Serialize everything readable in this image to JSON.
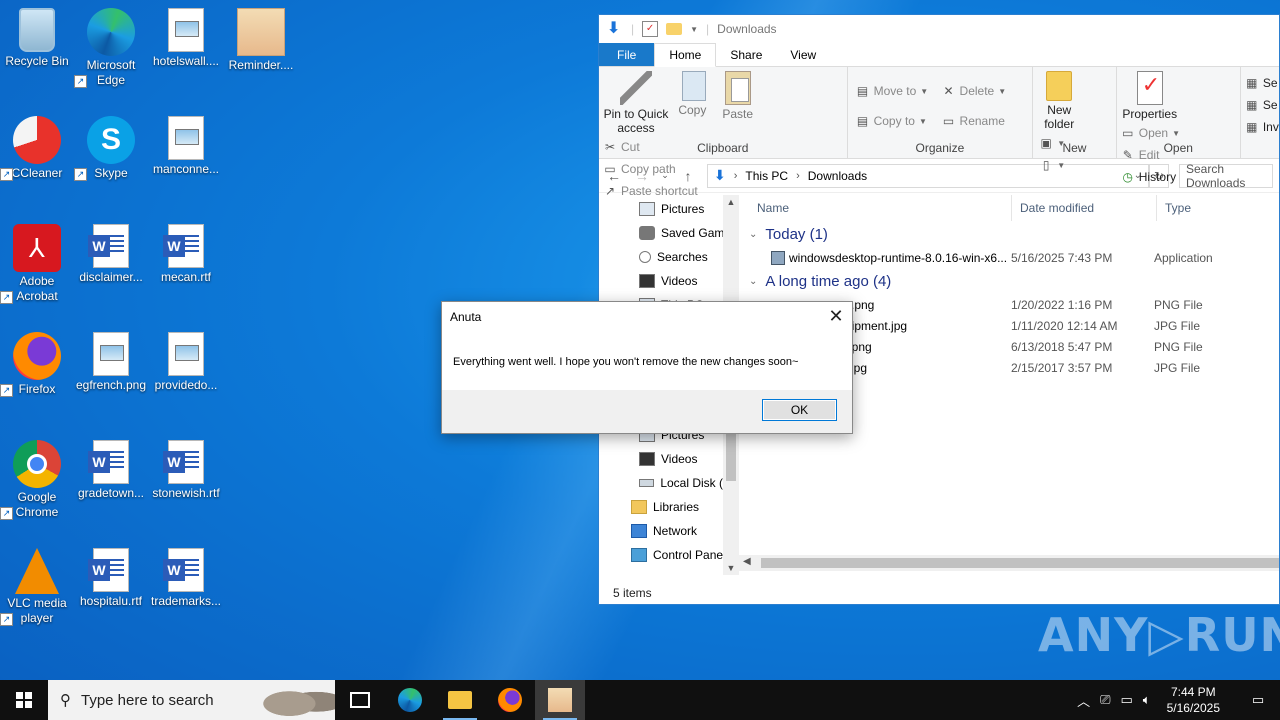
{
  "desktop": {
    "icons": [
      {
        "label": "Recycle Bin",
        "icon": "recycle-bin-icon"
      },
      {
        "label": "Microsoft Edge",
        "icon": "edge-icon"
      },
      {
        "label": "hotelswall....",
        "icon": "image-file-icon"
      },
      {
        "label": "Reminder....",
        "icon": "anime-app-icon"
      },
      {
        "label": "CCleaner",
        "icon": "ccleaner-icon"
      },
      {
        "label": "Skype",
        "icon": "skype-icon"
      },
      {
        "label": "manconne...",
        "icon": "image-file-icon"
      },
      {
        "label": "Adobe Acrobat",
        "icon": "acrobat-icon"
      },
      {
        "label": "disclaimer...",
        "icon": "word-doc-icon"
      },
      {
        "label": "mecan.rtf",
        "icon": "word-doc-icon"
      },
      {
        "label": "Firefox",
        "icon": "firefox-icon"
      },
      {
        "label": "egfrench.png",
        "icon": "image-file-icon"
      },
      {
        "label": "providedo...",
        "icon": "image-file-icon"
      },
      {
        "label": "Google Chrome",
        "icon": "chrome-icon"
      },
      {
        "label": "gradetown...",
        "icon": "word-doc-icon"
      },
      {
        "label": "stonewish.rtf",
        "icon": "word-doc-icon"
      },
      {
        "label": "VLC media player",
        "icon": "vlc-icon"
      },
      {
        "label": "hospitalu.rtf",
        "icon": "word-doc-icon"
      },
      {
        "label": "trademarks...",
        "icon": "word-doc-icon"
      }
    ]
  },
  "explorer": {
    "title": "Downloads",
    "tabs": [
      "File",
      "Home",
      "Share",
      "View"
    ],
    "ribbon": {
      "clipboard": {
        "pin": "Pin to Quick access",
        "copy": "Copy",
        "paste": "Paste",
        "cut": "Cut",
        "copy_path": "Copy path",
        "paste_shortcut": "Paste shortcut",
        "label": "Clipboard"
      },
      "organize": {
        "move_to": "Move to",
        "copy_to": "Copy to",
        "delete": "Delete",
        "rename": "Rename",
        "label": "Organize"
      },
      "new": {
        "new_folder": "New folder",
        "label": "New"
      },
      "open": {
        "properties": "Properties",
        "open": "Open",
        "edit": "Edit",
        "history": "History",
        "label": "Open"
      },
      "select": {
        "a": "Se",
        "b": "Se",
        "c": "Inv"
      }
    },
    "address": {
      "path": [
        "This PC",
        "Downloads"
      ],
      "search_placeholder": "Search Downloads"
    },
    "nav_pane": [
      {
        "label": "Pictures",
        "icon": "pictures-icon"
      },
      {
        "label": "Saved Games",
        "icon": "saved-games-icon"
      },
      {
        "label": "Searches",
        "icon": "searches-icon"
      },
      {
        "label": "Videos",
        "icon": "videos-icon"
      },
      {
        "label": "This PC",
        "icon": "this-pc-icon"
      }
    ],
    "nav_pane_lower": [
      {
        "label": "Pictures",
        "icon": "pictures-icon"
      },
      {
        "label": "Videos",
        "icon": "videos-icon"
      },
      {
        "label": "Local Disk (C:)",
        "icon": "disk-icon"
      },
      {
        "label": "Libraries",
        "icon": "libraries-icon"
      },
      {
        "label": "Network",
        "icon": "network-icon"
      },
      {
        "label": "Control Panel",
        "icon": "control-panel-icon"
      }
    ],
    "columns": {
      "name": "Name",
      "date": "Date modified",
      "type": "Type"
    },
    "groups": {
      "today": {
        "label": "Today (1)",
        "files": [
          {
            "name": "windowsdesktop-runtime-8.0.16-win-x6...",
            "date": "5/16/2025 7:43 PM",
            "type": "Application"
          }
        ]
      },
      "old": {
        "label": "A long time ago (4)",
        "files": [
          {
            "name": "s.png",
            "date": "1/20/2022 1:16 PM",
            "type": "PNG File"
          },
          {
            "name": "uipment.jpg",
            "date": "1/11/2020 12:14 AM",
            "type": "JPG File"
          },
          {
            "name": "t.png",
            "date": "6/13/2018 5:47 PM",
            "type": "PNG File"
          },
          {
            "name": "l.jpg",
            "date": "2/15/2017 3:57 PM",
            "type": "JPG File"
          }
        ]
      }
    },
    "status": "5 items"
  },
  "dialog": {
    "title": "Anuta",
    "message": "Everything went well. I hope you won't remove the new changes soon~",
    "ok": "OK"
  },
  "watermark": "ANY▷RUN",
  "taskbar": {
    "search_placeholder": "Type here to search",
    "time": "7:44 PM",
    "date": "5/16/2025"
  }
}
